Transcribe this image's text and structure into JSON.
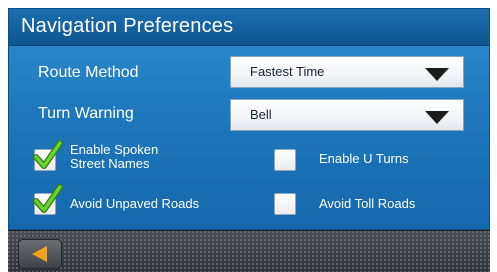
{
  "header": {
    "title": "Navigation Preferences"
  },
  "route_method": {
    "label": "Route Method",
    "value": "Fastest Time",
    "icon": "triangle-down-icon"
  },
  "turn_warning": {
    "label": "Turn Warning",
    "value": "Bell",
    "icon": "triangle-down-icon"
  },
  "options": [
    {
      "label_line1": "Enable Spoken",
      "label_line2": "Street Names",
      "checked": true
    },
    {
      "label": "Enable U Turns",
      "checked": false
    },
    {
      "label": "Avoid Unpaved Roads",
      "checked": true
    },
    {
      "label": "Avoid Toll Roads",
      "checked": false
    }
  ],
  "footer": {
    "back_icon": "back-arrow-icon"
  },
  "colors": {
    "panel_blue": "#1f78bd",
    "header_blue": "#0f568f",
    "checkmark_green": "#4caf1e",
    "back_arrow_orange": "#f3a21a",
    "footer_gray": "#3a3d42"
  }
}
